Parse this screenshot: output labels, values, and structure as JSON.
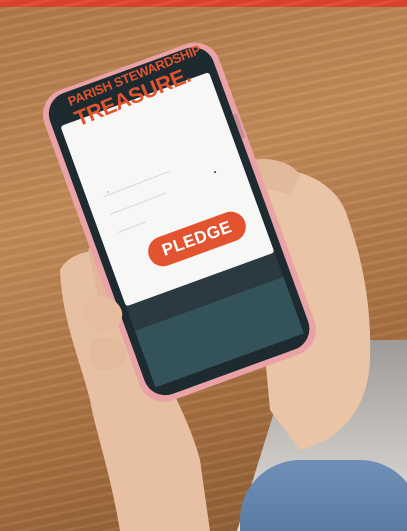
{
  "phone_screen": {
    "kicker": "PARISH STEWARDSHIP",
    "headline": "TREASURE.",
    "button_label": "PLEDGE"
  },
  "colors": {
    "brand_orange": "#e2542f",
    "stripe_red": "#e0452c",
    "phone_case": "#e9a3a6",
    "screen_white": "#f7f7f5"
  }
}
